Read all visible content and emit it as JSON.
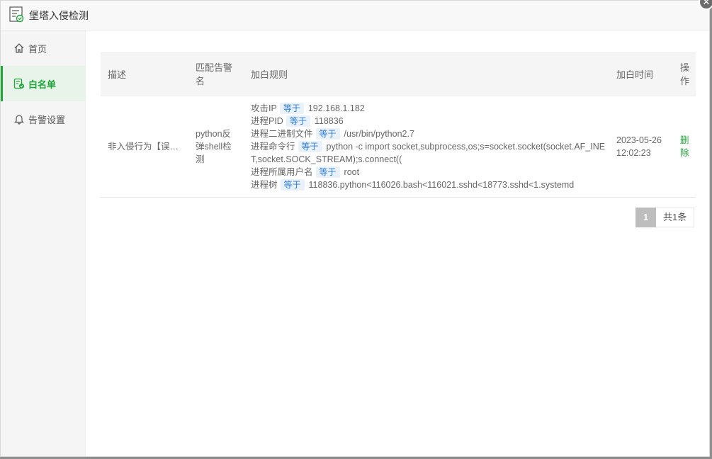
{
  "window": {
    "title": "堡塔入侵检测",
    "close_icon": "close-icon"
  },
  "sidebar": {
    "items": [
      {
        "label": "首页",
        "icon": "home-icon",
        "active": false
      },
      {
        "label": "白名单",
        "icon": "whitelist-icon",
        "active": true
      },
      {
        "label": "告警设置",
        "icon": "bell-icon",
        "active": false
      }
    ]
  },
  "table": {
    "headers": [
      "描述",
      "匹配告警名",
      "加白规则",
      "加白时间",
      "操作"
    ],
    "rows": [
      {
        "desc": "非入侵行为【误报】",
        "match": "python反弹shell检测",
        "rules": [
          {
            "key": "攻击IP",
            "op": "等于",
            "value": "192.168.1.182"
          },
          {
            "key": "进程PID",
            "op": "等于",
            "value": "118836"
          },
          {
            "key": "进程二进制文件",
            "op": "等于",
            "value": "/usr/bin/python2.7"
          },
          {
            "key": "进程命令行",
            "op": "等于",
            "value": "python -c import socket,subprocess,os;s=socket.socket(socket.AF_INET,socket.SOCK_STREAM);s.connect(("
          },
          {
            "key": "进程所属用户名",
            "op": "等于",
            "value": "root"
          },
          {
            "key": "进程树",
            "op": "等于",
            "value": "118836.python<116026.bash<116021.sshd<18773.sshd<1.systemd"
          }
        ],
        "time": "2023-05-26 12:02:23",
        "action": "删除"
      }
    ]
  },
  "pagination": {
    "current": "1",
    "total": "共1条"
  },
  "colors": {
    "accent": "#20a53a",
    "tag_text": "#2c7cd6",
    "tag_bg": "#e9f2fb"
  }
}
